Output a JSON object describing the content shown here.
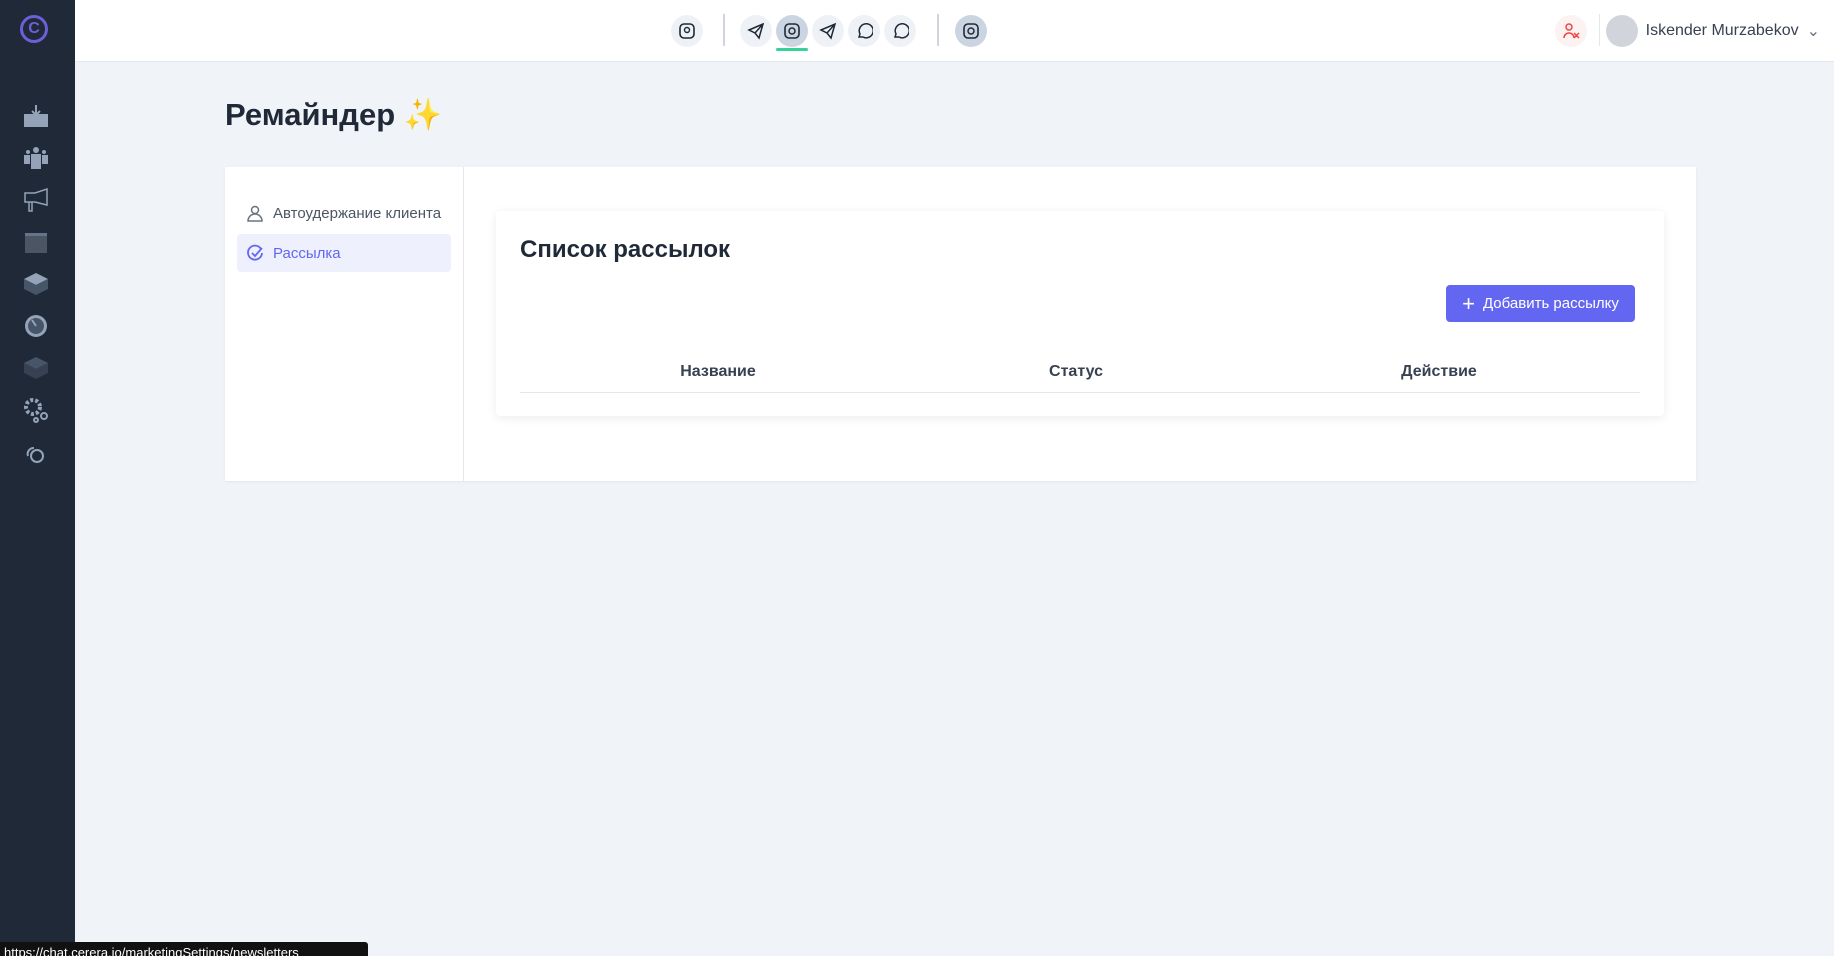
{
  "app": {
    "logo_letter": "C"
  },
  "header": {
    "user_name": "Iskender Murzabekov"
  },
  "page": {
    "title": "Ремайндер ✨"
  },
  "nav": {
    "items": [
      {
        "label": "Автоудержание клиента"
      },
      {
        "label": "Рассылка"
      }
    ]
  },
  "main": {
    "title": "Список рассылок",
    "add_button": "Добавить рассылку",
    "columns": [
      "Название",
      "Статус",
      "Действие"
    ]
  },
  "statusbar": {
    "url": "https://chat.cerera.io/marketingSettings/newsletters"
  },
  "colors": {
    "accent": "#6366f1",
    "sidebar": "#1f2937",
    "active_underline": "#34d399"
  }
}
